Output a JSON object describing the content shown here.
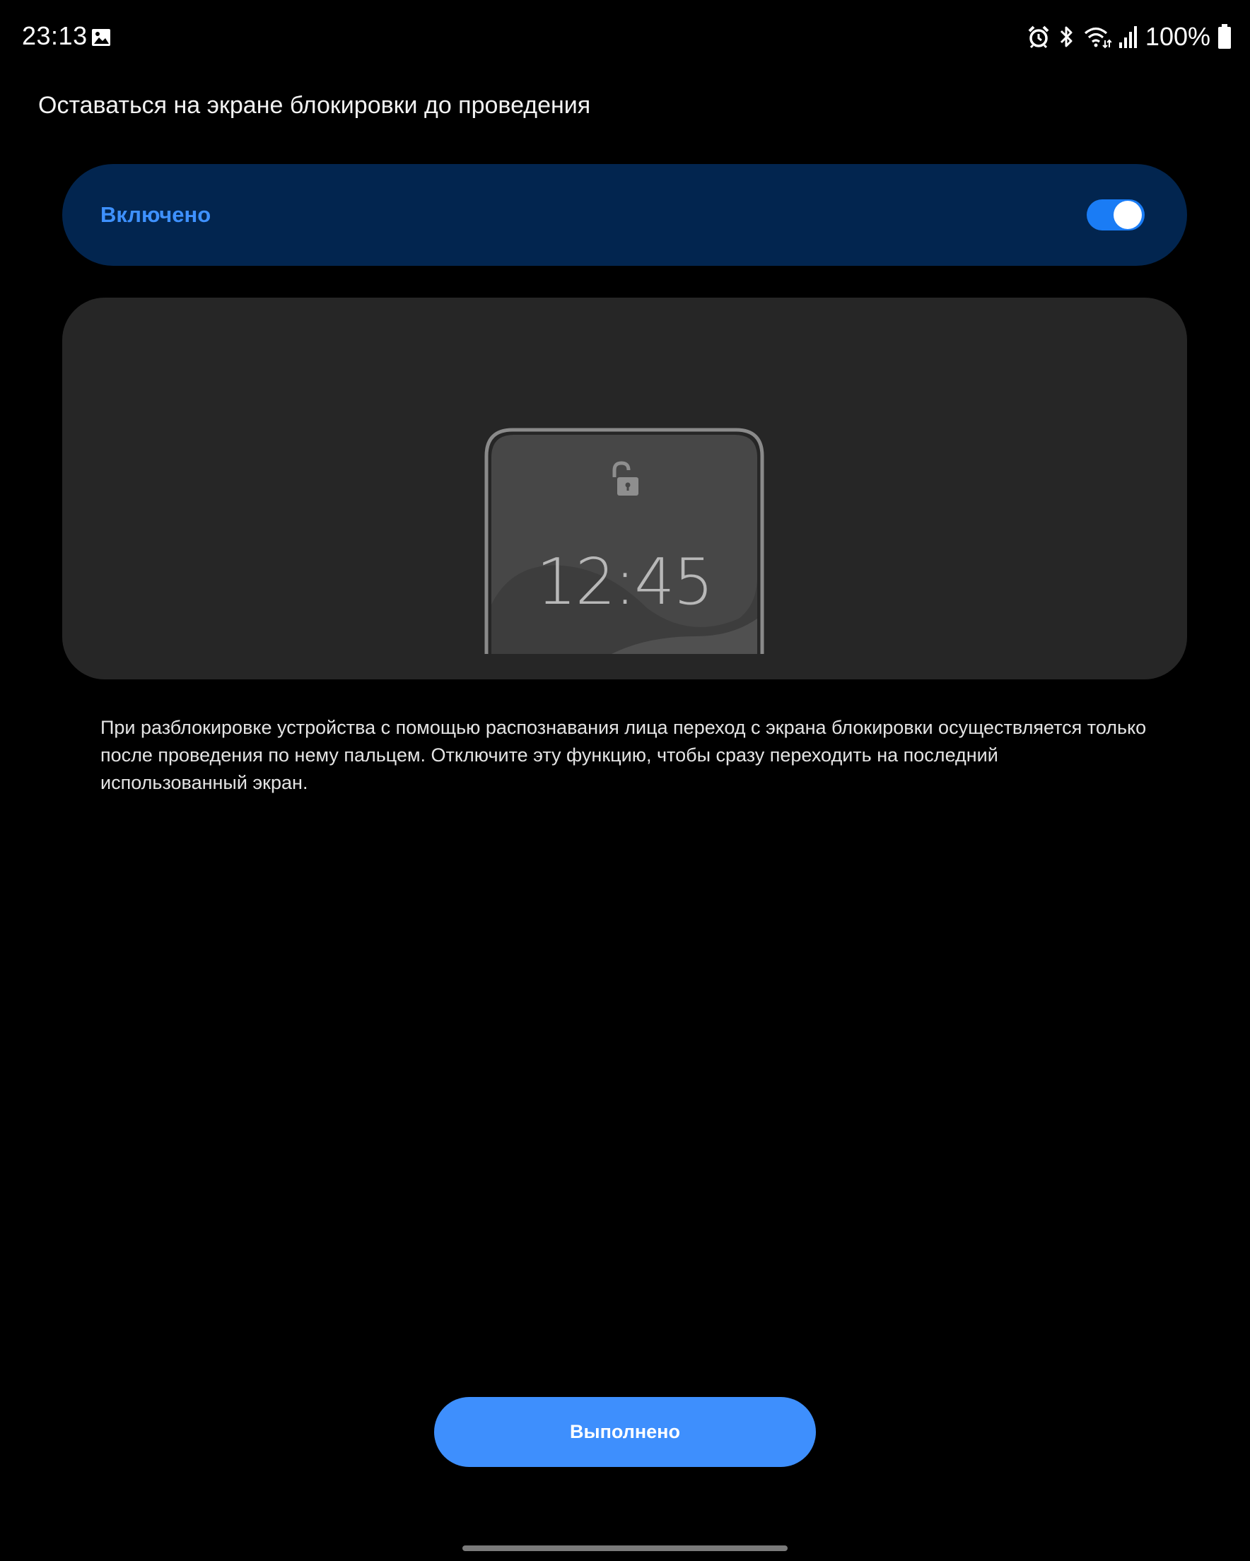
{
  "status_bar": {
    "time": "23:13",
    "battery_percent": "100%",
    "icons": [
      "gallery-icon",
      "alarm-icon",
      "bluetooth-icon",
      "wifi-icon",
      "signal-icon",
      "battery-icon"
    ]
  },
  "header": {
    "title": "Оставаться на экране блокировки до проведения"
  },
  "main_switch": {
    "label": "Включено",
    "checked": true,
    "label_color": "#3e91ff",
    "background_color": "#02254f",
    "toggle_color": "#1a7cf5"
  },
  "illustration": {
    "lock_icon": "unlocked-padlock-icon",
    "clock_text": "12:45"
  },
  "description": {
    "text": "При разблокировке устройства с помощью распознавания лица переход с экрана блокировки осуществляется только после проведения по нему пальцем. Отключите эту функцию, чтобы сразу переходить на последний использованный экран."
  },
  "footer": {
    "done_label": "Выполнено",
    "done_color": "#3e8ffd"
  }
}
